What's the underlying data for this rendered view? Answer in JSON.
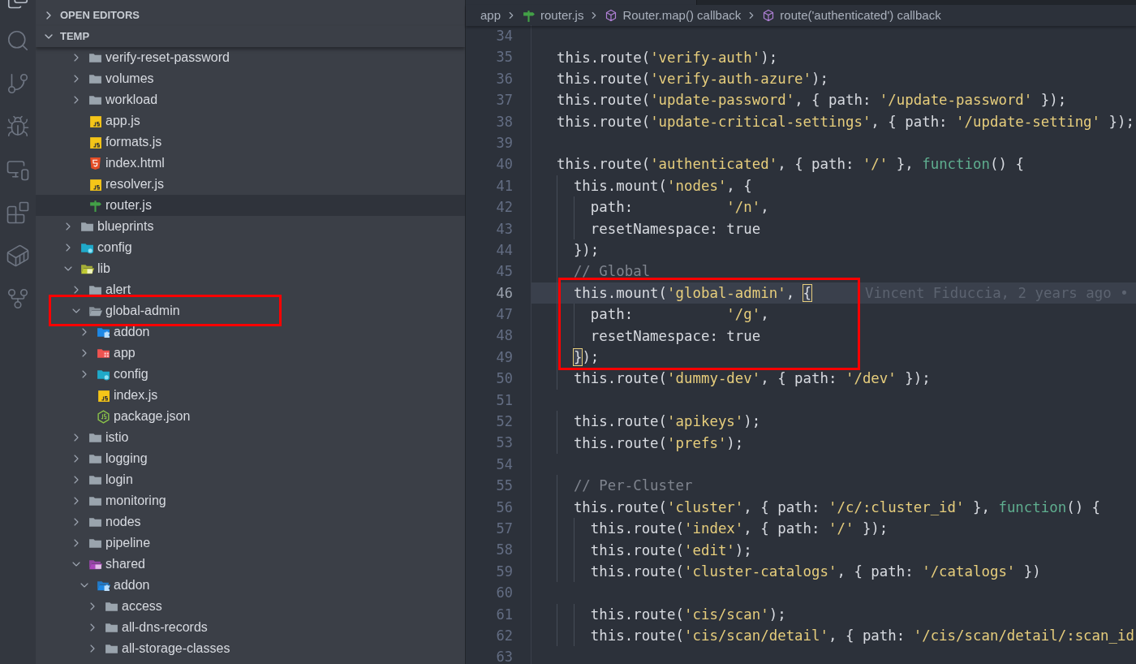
{
  "activity_bar": {
    "items": [
      {
        "kind": "explorer",
        "selected": true
      },
      {
        "kind": "search",
        "selected": false
      },
      {
        "kind": "source-control",
        "selected": false
      },
      {
        "kind": "run-debug",
        "selected": false
      },
      {
        "kind": "remote",
        "selected": false
      },
      {
        "kind": "extensions",
        "selected": false
      },
      {
        "kind": "docker",
        "selected": false
      },
      {
        "kind": "git-graph",
        "selected": false
      }
    ]
  },
  "explorer": {
    "sections": [
      {
        "title": "OPEN EDITORS",
        "expanded": false
      },
      {
        "title": "TEMP",
        "expanded": true,
        "items": [
          {
            "kind": "nested",
            "children": [
              {
                "name": "verify-reset-password",
                "kind": "folder",
                "expanded": false,
                "selected": false,
                "boxed": false
              },
              {
                "name": "volumes",
                "kind": "folder",
                "expanded": false,
                "selected": false,
                "boxed": false
              },
              {
                "name": "workload",
                "kind": "folder",
                "expanded": false,
                "selected": false,
                "boxed": false
              },
              {
                "name": "app.js",
                "kind": "js",
                "selected": false,
                "boxed": false
              },
              {
                "name": "formats.js",
                "kind": "js",
                "selected": false,
                "boxed": false
              },
              {
                "name": "index.html",
                "kind": "html",
                "selected": false,
                "boxed": false
              },
              {
                "name": "resolver.js",
                "kind": "js",
                "selected": false,
                "boxed": false
              },
              {
                "name": "router.js",
                "kind": "router",
                "selected": true,
                "boxed": false
              }
            ]
          },
          {
            "name": "blueprints",
            "kind": "folder",
            "expanded": false,
            "selected": false,
            "boxed": false
          },
          {
            "name": "config",
            "kind": "folder-config",
            "expanded": false,
            "selected": false,
            "boxed": false
          },
          {
            "name": "lib",
            "kind": "folder-lib",
            "expanded": true,
            "selected": false,
            "boxed": false,
            "children": [
              {
                "name": "alert",
                "kind": "folder",
                "expanded": false,
                "selected": false,
                "boxed": false
              },
              {
                "name": "global-admin",
                "kind": "folder",
                "expanded": true,
                "selected": false,
                "boxed": true,
                "children": [
                  {
                    "name": "addon",
                    "kind": "folder-addon",
                    "expanded": false,
                    "selected": false,
                    "boxed": false
                  },
                  {
                    "name": "app",
                    "kind": "folder-app",
                    "expanded": false,
                    "selected": false,
                    "boxed": false
                  },
                  {
                    "name": "config",
                    "kind": "folder-config",
                    "expanded": false,
                    "selected": false,
                    "boxed": false
                  },
                  {
                    "name": "index.js",
                    "kind": "js",
                    "selected": false,
                    "boxed": false
                  },
                  {
                    "name": "package.json",
                    "kind": "node",
                    "selected": false,
                    "boxed": false
                  }
                ]
              },
              {
                "name": "istio",
                "kind": "folder",
                "expanded": false,
                "selected": false,
                "boxed": false
              },
              {
                "name": "logging",
                "kind": "folder",
                "expanded": false,
                "selected": false,
                "boxed": false
              },
              {
                "name": "login",
                "kind": "folder",
                "expanded": false,
                "selected": false,
                "boxed": false
              },
              {
                "name": "monitoring",
                "kind": "folder",
                "expanded": false,
                "selected": false,
                "boxed": false
              },
              {
                "name": "nodes",
                "kind": "folder",
                "expanded": false,
                "selected": false,
                "boxed": false
              },
              {
                "name": "pipeline",
                "kind": "folder",
                "expanded": false,
                "selected": false,
                "boxed": false
              },
              {
                "name": "shared",
                "kind": "folder-shared",
                "expanded": true,
                "selected": false,
                "boxed": false,
                "children": [
                  {
                    "name": "addon",
                    "kind": "folder-addon",
                    "expanded": true,
                    "selected": false,
                    "boxed": false,
                    "children": [
                      {
                        "name": "access",
                        "kind": "folder",
                        "expanded": false,
                        "selected": false,
                        "boxed": false
                      },
                      {
                        "name": "all-dns-records",
                        "kind": "folder",
                        "expanded": false,
                        "selected": false,
                        "boxed": false
                      },
                      {
                        "name": "all-storage-classes",
                        "kind": "folder",
                        "expanded": false,
                        "selected": false,
                        "boxed": false
                      }
                    ]
                  }
                ]
              }
            ]
          }
        ]
      }
    ]
  },
  "breadcrumb": [
    {
      "text": "app",
      "kind": "plain"
    },
    {
      "text": "router.js",
      "kind": "router"
    },
    {
      "text": "Router.map() callback",
      "kind": "symbol"
    },
    {
      "text": "route('authenticated') callback",
      "kind": "symbol"
    }
  ],
  "editor": {
    "lines": [
      {
        "number": "34",
        "current": false,
        "boxed": false
      },
      {
        "number": "35",
        "current": false,
        "boxed": false,
        "tokens": [
          {
            "text": "  this.route(",
            "kind": "plain"
          },
          {
            "text": "'verify-auth'",
            "kind": "string"
          },
          {
            "text": ");",
            "kind": "plain"
          }
        ]
      },
      {
        "number": "36",
        "current": false,
        "boxed": false,
        "tokens": [
          {
            "text": "  this.route(",
            "kind": "plain"
          },
          {
            "text": "'verify-auth-azure'",
            "kind": "string"
          },
          {
            "text": ");",
            "kind": "plain"
          }
        ]
      },
      {
        "number": "37",
        "current": false,
        "boxed": false,
        "tokens": [
          {
            "text": "  this.route(",
            "kind": "plain"
          },
          {
            "text": "'update-password'",
            "kind": "string"
          },
          {
            "text": ", { path: ",
            "kind": "plain"
          },
          {
            "text": "'/update-password'",
            "kind": "string"
          },
          {
            "text": " });",
            "kind": "plain"
          }
        ]
      },
      {
        "number": "38",
        "current": false,
        "boxed": false,
        "tokens": [
          {
            "text": "  this.route(",
            "kind": "plain"
          },
          {
            "text": "'update-critical-settings'",
            "kind": "string"
          },
          {
            "text": ", { path: ",
            "kind": "plain"
          },
          {
            "text": "'/update-setting'",
            "kind": "string"
          },
          {
            "text": " });",
            "kind": "plain"
          }
        ]
      },
      {
        "number": "39",
        "current": false,
        "boxed": false
      },
      {
        "number": "40",
        "current": false,
        "boxed": false,
        "tokens": [
          {
            "text": "  this.route(",
            "kind": "plain"
          },
          {
            "text": "'authenticated'",
            "kind": "string"
          },
          {
            "text": ", { path: ",
            "kind": "plain"
          },
          {
            "text": "'/'",
            "kind": "string"
          },
          {
            "text": " }, ",
            "kind": "plain"
          },
          {
            "text": "function",
            "kind": "keyword"
          },
          {
            "text": "() {",
            "kind": "plain"
          }
        ]
      },
      {
        "number": "41",
        "current": false,
        "boxed": false,
        "tokens": [
          {
            "text": "    this.mount(",
            "kind": "plain"
          },
          {
            "text": "'nodes'",
            "kind": "string"
          },
          {
            "text": ", {",
            "kind": "plain"
          }
        ]
      },
      {
        "number": "42",
        "current": false,
        "boxed": false,
        "tokens": [
          {
            "text": "      path:           ",
            "kind": "plain"
          },
          {
            "text": "'/n'",
            "kind": "string"
          },
          {
            "text": ",",
            "kind": "plain"
          }
        ]
      },
      {
        "number": "43",
        "current": false,
        "boxed": false,
        "tokens": [
          {
            "text": "      resetNamespace: true",
            "kind": "plain"
          }
        ]
      },
      {
        "number": "44",
        "current": false,
        "boxed": false,
        "tokens": [
          {
            "text": "    });",
            "kind": "plain"
          }
        ]
      },
      {
        "number": "45",
        "current": false,
        "boxed": false,
        "tokens": [
          {
            "text": "    // Global",
            "kind": "comment"
          }
        ]
      },
      {
        "number": "46",
        "current": true,
        "boxed": true,
        "blame": "Vincent Fiduccia, 2 years ago •",
        "tokens": [
          {
            "text": "    this.mount(",
            "kind": "plain"
          },
          {
            "text": "'global-admin'",
            "kind": "string"
          },
          {
            "text": ", ",
            "kind": "plain"
          },
          {
            "text": "{",
            "kind": "bracket"
          }
        ]
      },
      {
        "number": "47",
        "current": false,
        "boxed": true,
        "tokens": [
          {
            "text": "      path:           ",
            "kind": "plain"
          },
          {
            "text": "'/g'",
            "kind": "string"
          },
          {
            "text": ",",
            "kind": "plain"
          }
        ]
      },
      {
        "number": "48",
        "current": false,
        "boxed": true,
        "tokens": [
          {
            "text": "      resetNamespace: true",
            "kind": "plain"
          }
        ]
      },
      {
        "number": "49",
        "current": false,
        "boxed": true,
        "tokens": [
          {
            "text": "    }",
            "kind": "bracket"
          },
          {
            "text": ");",
            "kind": "plain"
          }
        ]
      },
      {
        "number": "50",
        "current": false,
        "boxed": false,
        "tokens": [
          {
            "text": "    this.route(",
            "kind": "plain"
          },
          {
            "text": "'dummy-dev'",
            "kind": "string"
          },
          {
            "text": ", { path: ",
            "kind": "plain"
          },
          {
            "text": "'/dev'",
            "kind": "string"
          },
          {
            "text": " });",
            "kind": "plain"
          }
        ]
      },
      {
        "number": "51",
        "current": false,
        "boxed": false
      },
      {
        "number": "52",
        "current": false,
        "boxed": false,
        "tokens": [
          {
            "text": "    this.route(",
            "kind": "plain"
          },
          {
            "text": "'apikeys'",
            "kind": "string"
          },
          {
            "text": ");",
            "kind": "plain"
          }
        ]
      },
      {
        "number": "53",
        "current": false,
        "boxed": false,
        "tokens": [
          {
            "text": "    this.route(",
            "kind": "plain"
          },
          {
            "text": "'prefs'",
            "kind": "string"
          },
          {
            "text": ");",
            "kind": "plain"
          }
        ]
      },
      {
        "number": "54",
        "current": false,
        "boxed": false
      },
      {
        "number": "55",
        "current": false,
        "boxed": false,
        "tokens": [
          {
            "text": "    // Per-Cluster",
            "kind": "comment"
          }
        ]
      },
      {
        "number": "56",
        "current": false,
        "boxed": false,
        "tokens": [
          {
            "text": "    this.route(",
            "kind": "plain"
          },
          {
            "text": "'cluster'",
            "kind": "string"
          },
          {
            "text": ", { path: ",
            "kind": "plain"
          },
          {
            "text": "'/c/:cluster_id'",
            "kind": "string"
          },
          {
            "text": " }, ",
            "kind": "plain"
          },
          {
            "text": "function",
            "kind": "keyword"
          },
          {
            "text": "() {",
            "kind": "plain"
          }
        ]
      },
      {
        "number": "57",
        "current": false,
        "boxed": false,
        "tokens": [
          {
            "text": "      this.route(",
            "kind": "plain"
          },
          {
            "text": "'index'",
            "kind": "string"
          },
          {
            "text": ", { path: ",
            "kind": "plain"
          },
          {
            "text": "'/'",
            "kind": "string"
          },
          {
            "text": " });",
            "kind": "plain"
          }
        ]
      },
      {
        "number": "58",
        "current": false,
        "boxed": false,
        "tokens": [
          {
            "text": "      this.route(",
            "kind": "plain"
          },
          {
            "text": "'edit'",
            "kind": "string"
          },
          {
            "text": ");",
            "kind": "plain"
          }
        ]
      },
      {
        "number": "59",
        "current": false,
        "boxed": false,
        "tokens": [
          {
            "text": "      this.route(",
            "kind": "plain"
          },
          {
            "text": "'cluster-catalogs'",
            "kind": "string"
          },
          {
            "text": ", { path: ",
            "kind": "plain"
          },
          {
            "text": "'/catalogs'",
            "kind": "string"
          },
          {
            "text": " })",
            "kind": "plain"
          }
        ]
      },
      {
        "number": "60",
        "current": false,
        "boxed": false
      },
      {
        "number": "61",
        "current": false,
        "boxed": false,
        "tokens": [
          {
            "text": "      this.route(",
            "kind": "plain"
          },
          {
            "text": "'cis/scan'",
            "kind": "string"
          },
          {
            "text": ");",
            "kind": "plain"
          }
        ]
      },
      {
        "number": "62",
        "current": false,
        "boxed": false,
        "tokens": [
          {
            "text": "      this.route(",
            "kind": "plain"
          },
          {
            "text": "'cis/scan/detail'",
            "kind": "string"
          },
          {
            "text": ", { path: ",
            "kind": "plain"
          },
          {
            "text": "'/cis/scan/detail/:scan_id",
            "kind": "string"
          }
        ]
      },
      {
        "number": "63",
        "current": false,
        "boxed": false
      }
    ]
  }
}
